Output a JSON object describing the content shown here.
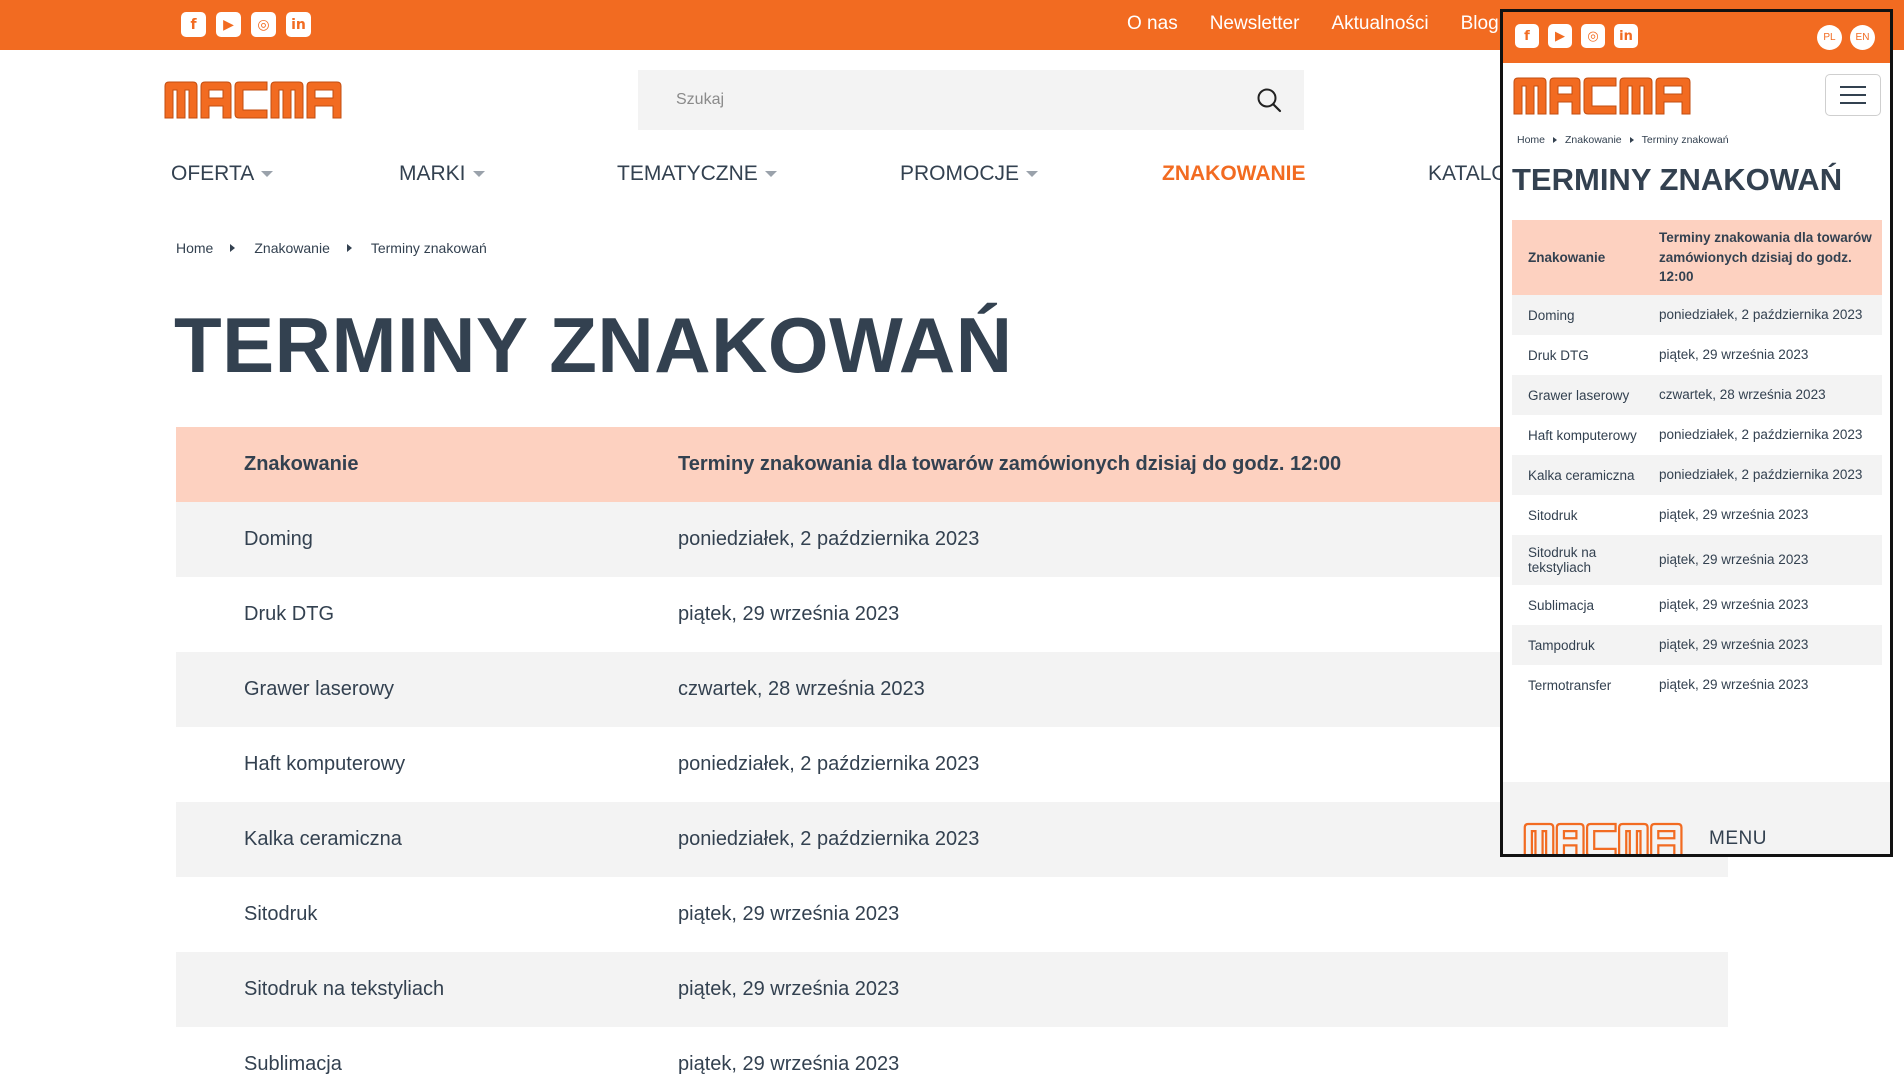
{
  "colors": {
    "brand": "#f26b21",
    "text": "#334150",
    "table_header_bg": "#fdd1c0",
    "row_alt_bg": "#f3f3f3"
  },
  "social_icons": [
    "facebook-icon",
    "youtube-icon",
    "instagram-icon",
    "linkedin-icon"
  ],
  "topnav": {
    "about": "O nas",
    "newsletter": "Newsletter",
    "news": "Aktualności",
    "blog": "Blog"
  },
  "logo": {
    "text": "MACMA"
  },
  "search": {
    "placeholder": "Szukaj"
  },
  "mainnav": {
    "offer": "OFERTA",
    "brands": "MARKI",
    "thematic": "TEMATYCZNE",
    "promotions": "PROMOCJE",
    "marking": "ZNAKOWANIE",
    "catalogs": "KATALOGI"
  },
  "breadcrumb": {
    "home": "Home",
    "marking": "Znakowanie",
    "current": "Terminy znakowań"
  },
  "page": {
    "title": "TERMINY ZNAKOWAŃ"
  },
  "table": {
    "headers": {
      "method": "Znakowanie",
      "deadline": "Terminy znakowania dla towarów zamówionych dzisiaj do godz. 12:00"
    },
    "rows": [
      {
        "method": "Doming",
        "date": "poniedziałek, 2 października 2023"
      },
      {
        "method": "Druk DTG",
        "date": "piątek, 29 września 2023"
      },
      {
        "method": "Grawer laserowy",
        "date": "czwartek, 28 września 2023"
      },
      {
        "method": "Haft komputerowy",
        "date": "poniedziałek, 2 października 2023"
      },
      {
        "method": "Kalka ceramiczna",
        "date": "poniedziałek, 2 października 2023"
      },
      {
        "method": "Sitodruk",
        "date": "piątek, 29 września 2023"
      },
      {
        "method": "Sitodruk na tekstyliach",
        "date": "piątek, 29 września 2023"
      },
      {
        "method": "Sublimacja",
        "date": "piątek, 29 września 2023"
      },
      {
        "method": "Tampodruk",
        "date": "piątek, 29 września 2023"
      },
      {
        "method": "Termotransfer",
        "date": "piątek, 29 września 2023"
      }
    ]
  },
  "mobile": {
    "languages": {
      "pl": "PL",
      "en": "EN"
    },
    "footer_menu": "MENU"
  }
}
